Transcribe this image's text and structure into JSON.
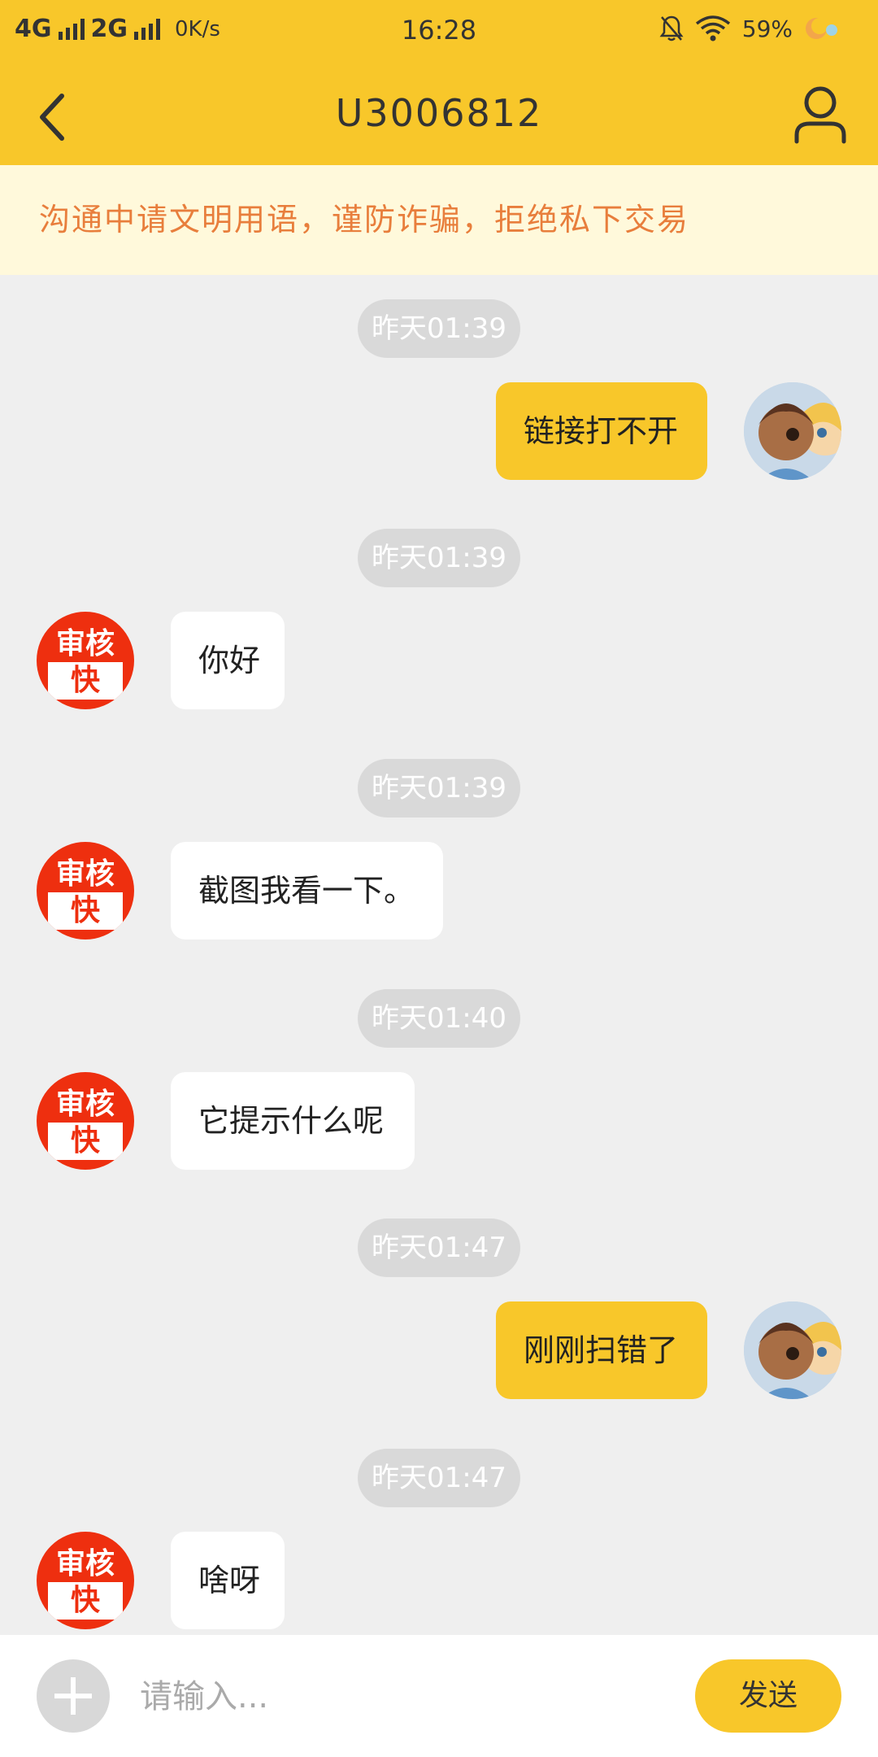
{
  "status_bar": {
    "net1": "4G",
    "net2": "2G",
    "speed": "0K/s",
    "time": "16:28",
    "battery": "59%"
  },
  "header": {
    "title": "U3006812"
  },
  "notice": "沟通中请文明用语，谨防诈骗，拒绝私下交易",
  "avatar_bot": {
    "top": "审核",
    "bottom": "快"
  },
  "messages": [
    {
      "time": "昨天01:39",
      "from": "user",
      "text": "链接打不开"
    },
    {
      "time": "昨天01:39",
      "from": "bot",
      "text": "你好"
    },
    {
      "time": "昨天01:39",
      "from": "bot",
      "text": "截图我看一下。"
    },
    {
      "time": "昨天01:40",
      "from": "bot",
      "text": "它提示什么呢"
    },
    {
      "time": "昨天01:47",
      "from": "user",
      "text": "刚刚扫错了"
    },
    {
      "time": "昨天01:47",
      "from": "bot",
      "text": "啥呀"
    }
  ],
  "input": {
    "placeholder": "请输入..."
  },
  "send_label": "发送",
  "colors": {
    "accent": "#f8c72a",
    "notice_text": "#e87e3c",
    "bot_avatar": "#ee2f0f"
  }
}
